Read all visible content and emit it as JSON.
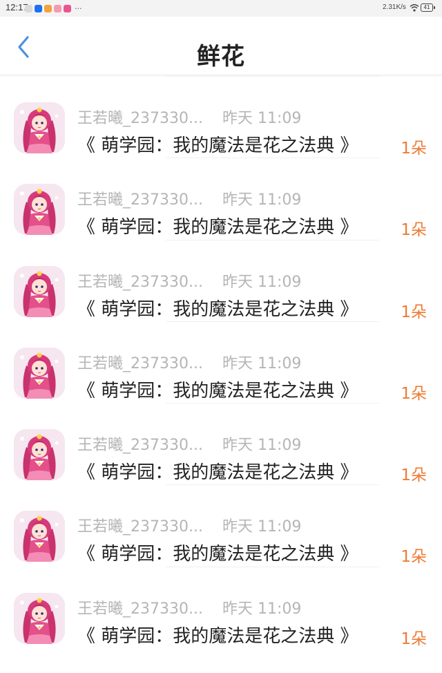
{
  "status_bar": {
    "time": "12:17",
    "app_icon_colors": [
      "#d9d9d9",
      "#1e6ff0",
      "#f2a33a",
      "#f59ab0",
      "#e9558d"
    ],
    "more": "···",
    "network_speed": "2.31K/s",
    "battery": "41"
  },
  "header": {
    "title": "鲜花"
  },
  "colors": {
    "accent_back": "#4a90e2",
    "gift_count": "#ee7a33",
    "secondary_text": "#b5b5b5"
  },
  "items": [
    {
      "user": "王若曦_237330...",
      "time": "昨天 11:09",
      "book": "《 萌学园：我的魔法是花之法典 》",
      "count": "1朵"
    },
    {
      "user": "王若曦_237330...",
      "time": "昨天 11:09",
      "book": "《 萌学园：我的魔法是花之法典 》",
      "count": "1朵"
    },
    {
      "user": "王若曦_237330...",
      "time": "昨天 11:09",
      "book": "《 萌学园：我的魔法是花之法典 》",
      "count": "1朵"
    },
    {
      "user": "王若曦_237330...",
      "time": "昨天 11:09",
      "book": "《 萌学园：我的魔法是花之法典 》",
      "count": "1朵"
    },
    {
      "user": "王若曦_237330...",
      "time": "昨天 11:09",
      "book": "《 萌学园：我的魔法是花之法典 》",
      "count": "1朵"
    },
    {
      "user": "王若曦_237330...",
      "time": "昨天 11:09",
      "book": "《 萌学园：我的魔法是花之法典 》",
      "count": "1朵"
    },
    {
      "user": "王若曦_237330...",
      "time": "昨天 11:09",
      "book": "《 萌学园：我的魔法是花之法典 》",
      "count": "1朵"
    }
  ]
}
